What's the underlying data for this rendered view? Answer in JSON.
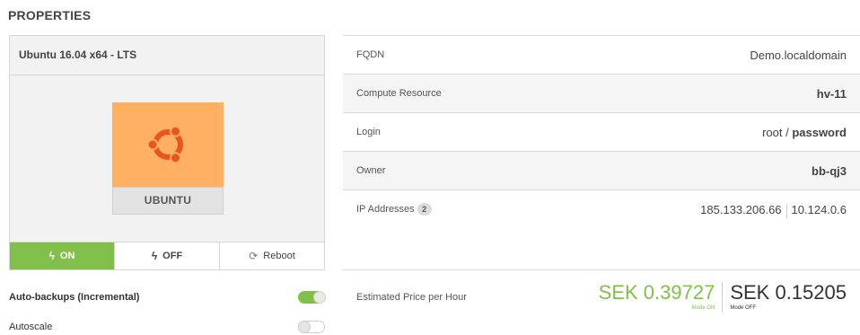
{
  "section_title": "PROPERTIES",
  "os": {
    "header": "Ubuntu 16.04 x64 - LTS",
    "name": "UBUNTU",
    "logo_color": "#ffb061"
  },
  "power": {
    "on_label": "ON",
    "off_label": "OFF",
    "reboot_label": "Reboot",
    "active": "on"
  },
  "options": [
    {
      "label": "Auto-backups (Incremental)",
      "state": "on"
    },
    {
      "label": "Autoscale",
      "state": "off"
    }
  ],
  "properties": {
    "fqdn_label": "FQDN",
    "fqdn_value": "Demo.localdomain",
    "compute_label": "Compute Resource",
    "compute_value": "hv-11",
    "login_label": "Login",
    "login_user": "root /",
    "login_password": "password",
    "owner_label": "Owner",
    "owner_value": "bb-qj3",
    "ip_label": "IP Addresses",
    "ip_count": "2",
    "ip_1": "185.133.206.66",
    "ip_2": "10.124.0.6"
  },
  "price": {
    "label": "Estimated Price per Hour",
    "on_value": "SEK 0.39727",
    "on_mode": "Mode ON",
    "off_value": "SEK 0.15205",
    "off_mode": "Mode OFF"
  },
  "colors": {
    "accent_green": "#80c04a",
    "ubuntu_orange": "#ffb061",
    "ubuntu_logo": "#e95420"
  }
}
